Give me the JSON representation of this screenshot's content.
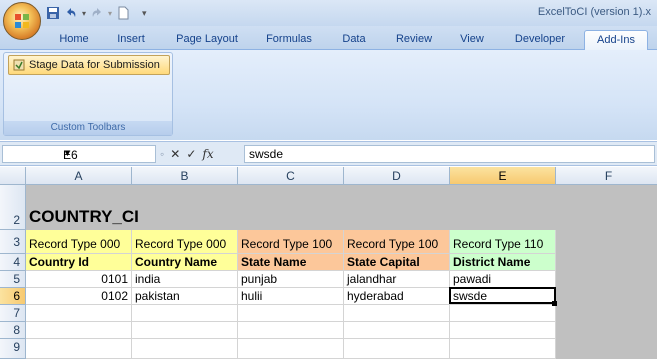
{
  "window": {
    "title": "ExcelToCI (version 1).x"
  },
  "tabs": [
    "Home",
    "Insert",
    "Page Layout",
    "Formulas",
    "Data",
    "Review",
    "View",
    "Developer",
    "Add-Ins"
  ],
  "active_tab": "Add-Ins",
  "ribbon": {
    "stage_button": "Stage Data for Submission",
    "group_caption": "Custom Toolbars"
  },
  "formula_bar": {
    "name_box": "E6",
    "fx": "fx",
    "value": "swsde"
  },
  "sheet": {
    "columns": [
      "A",
      "B",
      "C",
      "D",
      "E",
      "F"
    ],
    "rows": [
      "2",
      "3",
      "4",
      "5",
      "6",
      "7",
      "8",
      "9"
    ],
    "title": "COUNTRY_CI",
    "record_types": [
      "Record Type 000",
      "Record Type 000",
      "Record Type 100",
      "Record Type 100",
      "Record Type 110"
    ],
    "field_names": [
      "Country Id",
      "Country Name",
      "State Name",
      "State Capital",
      "District Name"
    ],
    "data_rows": [
      [
        "0101",
        "india",
        "punjab",
        "jalandhar",
        "pawadi"
      ],
      [
        "0102",
        "pakistan",
        "hulii",
        "hyderabad",
        "swsde"
      ]
    ],
    "fill_colors": {
      "yellow": "#ffff99",
      "orange": "#fcc79a",
      "green": "#ccffcc"
    }
  }
}
